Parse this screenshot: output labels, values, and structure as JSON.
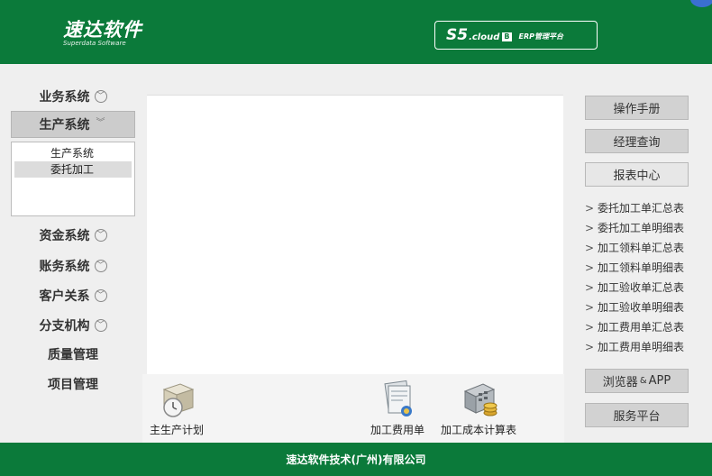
{
  "header": {
    "logo_main": "速达软件",
    "logo_sub": "Superdata Software",
    "product": {
      "s5": "S5",
      "cloud": ".cloud",
      "badge": "B",
      "erp": "ERP管理平台"
    }
  },
  "left_menu": {
    "items": [
      {
        "label": "业务系统",
        "icon": "chevron-down-circle-icon"
      },
      {
        "label": "生产系统",
        "icon": "chevron-down-double-icon"
      },
      {
        "label": "资金系统",
        "icon": "chevron-down-circle-icon"
      },
      {
        "label": "账务系统",
        "icon": "chevron-down-circle-icon"
      },
      {
        "label": "客户关系",
        "icon": "chevron-down-circle-icon"
      },
      {
        "label": "分支机构",
        "icon": "chevron-down-circle-icon"
      },
      {
        "label": "质量管理"
      },
      {
        "label": "项目管理"
      }
    ],
    "submenu": [
      "生产系统",
      "委托加工"
    ]
  },
  "shortcuts": [
    {
      "label": "主生产计划",
      "icon": "clock-box-icon"
    },
    {
      "label": "加工费用单",
      "icon": "document-stack-icon"
    },
    {
      "label": "加工成本计算表",
      "icon": "calculator-coins-icon"
    }
  ],
  "right_panel": {
    "manual": "操作手册",
    "manager_query": "经理查询",
    "report_center": "报表中心",
    "reports": [
      "委托加工单汇总表",
      "委托加工单明细表",
      "加工领料单汇总表",
      "加工领料单明细表",
      "加工验收单汇总表",
      "加工验收单明细表",
      "加工费用单汇总表",
      "加工费用单明细表"
    ],
    "browser_app": {
      "main": "浏览器",
      "amp": "&",
      "app": "APP"
    },
    "service_platform": "服务平台"
  },
  "footer": {
    "company": "速达软件技术(广州)有限公司"
  },
  "colors": {
    "brand_green": "#0b7a3a",
    "button_gray": "#d2d2d2"
  }
}
